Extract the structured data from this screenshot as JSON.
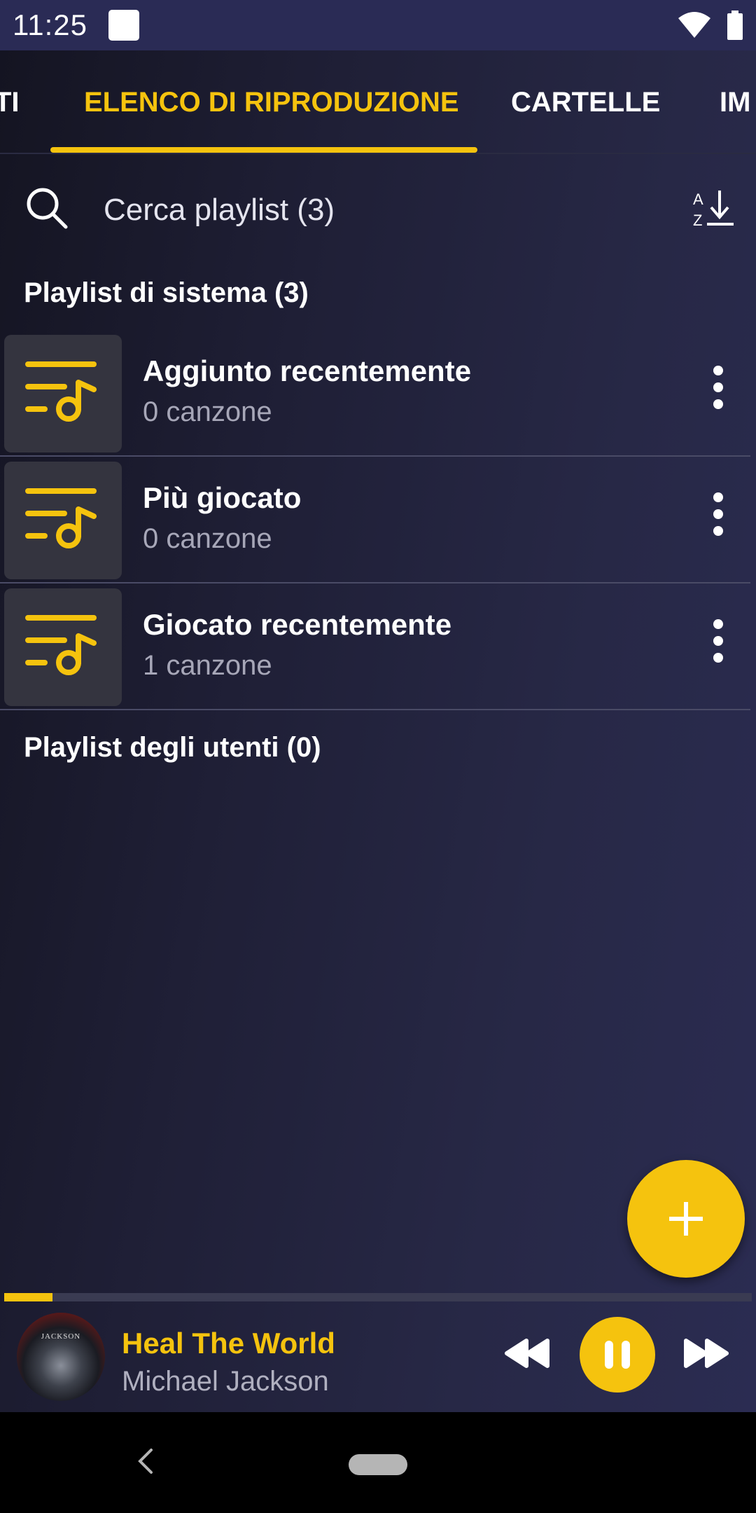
{
  "status_bar": {
    "time": "11:25"
  },
  "tabs": [
    {
      "label": "TI",
      "active": false
    },
    {
      "label": "ELENCO DI RIPRODUZIONE",
      "active": true
    },
    {
      "label": "CARTELLE",
      "active": false
    },
    {
      "label": "IM",
      "active": false
    }
  ],
  "search": {
    "placeholder": "Cerca playlist (3)",
    "value": ""
  },
  "system_playlists": {
    "title": "Playlist di sistema (3)",
    "items": [
      {
        "title": "Aggiunto recentemente",
        "subtitle": "0 canzone",
        "icon": "playlist-music-icon"
      },
      {
        "title": "Più giocato",
        "subtitle": "0 canzone",
        "icon": "playlist-music-icon"
      },
      {
        "title": "Giocato recentemente",
        "subtitle": "1 canzone",
        "icon": "playlist-music-icon"
      }
    ]
  },
  "user_playlists": {
    "title": "Playlist degli utenti (0)"
  },
  "fab": {
    "icon": "plus-icon"
  },
  "player": {
    "title": "Heal The World",
    "artist": "Michael Jackson",
    "progress_fraction": 0.065,
    "album_text": "JACKSON"
  },
  "colors": {
    "accent": "#f5c30e",
    "status_bar": "#2a2b55",
    "thumb_bg": "#34343f"
  }
}
